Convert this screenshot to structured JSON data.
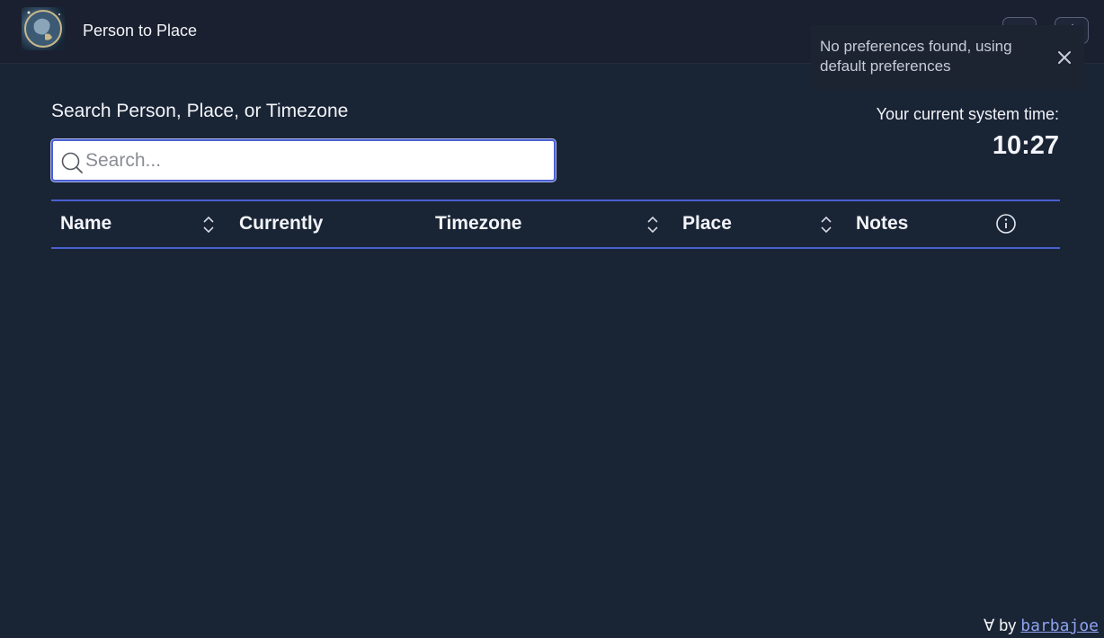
{
  "header": {
    "app_title": "Person to Place",
    "logo_icon": "globe-artwork-logo",
    "add_button_icon": "plus-icon",
    "settings_button_icon": "gear-icon"
  },
  "toast": {
    "message": "No preferences found, using default preferences",
    "close_icon": "close-icon"
  },
  "search": {
    "heading": "Search Person, Place, or Timezone",
    "placeholder": "Search...",
    "value": ""
  },
  "system_time": {
    "label": "Your current system time:",
    "value": "10:27"
  },
  "table": {
    "columns": [
      {
        "label": "Name",
        "sortable": true
      },
      {
        "label": "Currently",
        "sortable": false
      },
      {
        "label": "Timezone",
        "sortable": true
      },
      {
        "label": "Place",
        "sortable": true
      },
      {
        "label": "Notes",
        "sortable": false
      }
    ],
    "info_icon": "info-icon",
    "rows": []
  },
  "footer": {
    "prefix": "∀ by",
    "author_link": "barbajoe"
  },
  "colors": {
    "background": "#192435",
    "header_background": "#1b2030",
    "accent": "#4a5fd0",
    "link": "#8fa2ee"
  }
}
